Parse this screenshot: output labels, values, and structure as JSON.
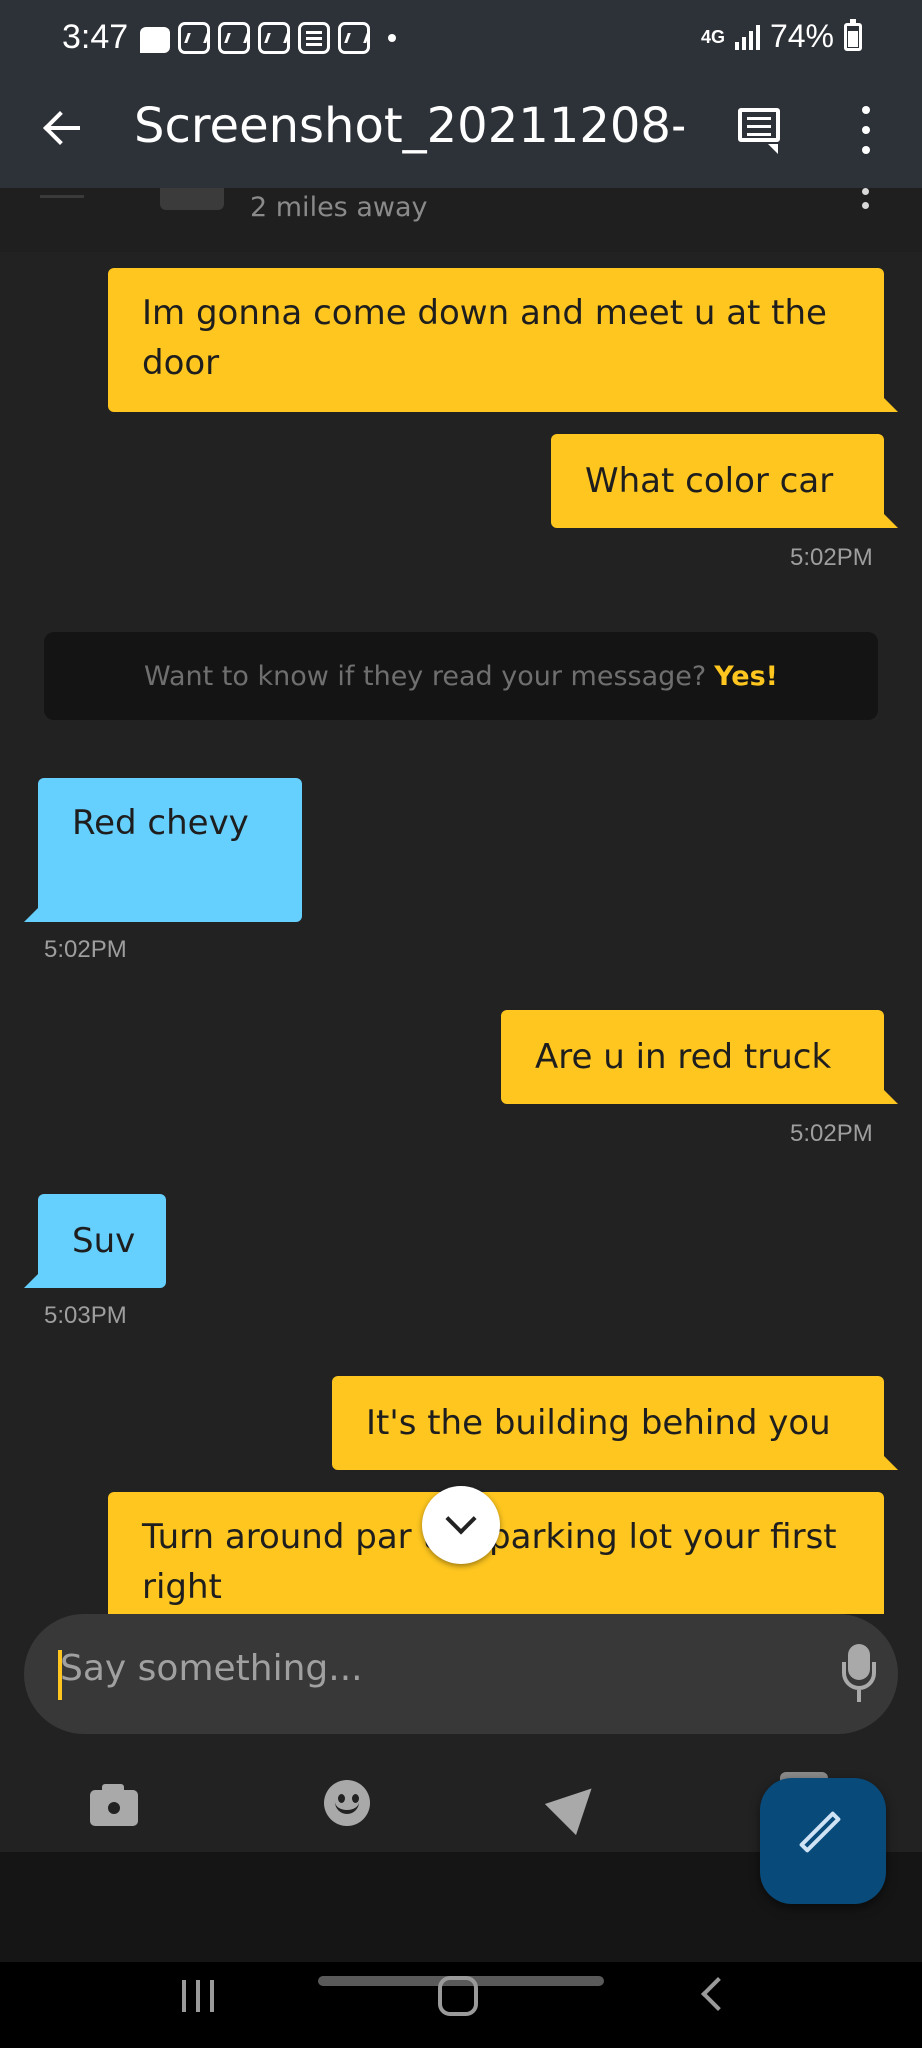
{
  "status_bar": {
    "time": "3:47",
    "network": "4G",
    "battery": "74%",
    "notification_icons": [
      "message-icon",
      "app-icon",
      "app-icon",
      "app-icon",
      "news-icon",
      "app-icon"
    ]
  },
  "app_bar": {
    "title": "Screenshot_20211208-...",
    "back_icon": "arrow-left-icon",
    "comment_icon": "comment-icon",
    "more_icon": "more-vert-icon"
  },
  "chat_header": {
    "distance": "2 miles away"
  },
  "messages": [
    {
      "dir": "out",
      "text": "Im gonna come down and meet u at the door"
    },
    {
      "dir": "out",
      "text": "What color car",
      "time": "5:02PM"
    },
    {
      "dir": "in",
      "text": "Red chevy",
      "time": "5:02PM"
    },
    {
      "dir": "out",
      "text": "Are u in red truck",
      "time": "5:02PM"
    },
    {
      "dir": "in",
      "text": "Suv",
      "time": "5:03PM"
    },
    {
      "dir": "out",
      "text": "It's the building behind you"
    },
    {
      "dir": "out",
      "text": "Turn around par the parking lot your first right"
    }
  ],
  "read_banner": {
    "text": "Want to know if they read your message?",
    "action": "Yes!"
  },
  "input": {
    "placeholder": "Say something..."
  },
  "toolbar": {
    "icons": [
      "camera-icon",
      "emoji-icon",
      "location-icon",
      "gallery-icon"
    ]
  },
  "colors": {
    "outgoing_bubble": "#fec61f",
    "incoming_bubble": "#65cffe",
    "background": "#222222",
    "compose_fab": "#084a7a"
  }
}
